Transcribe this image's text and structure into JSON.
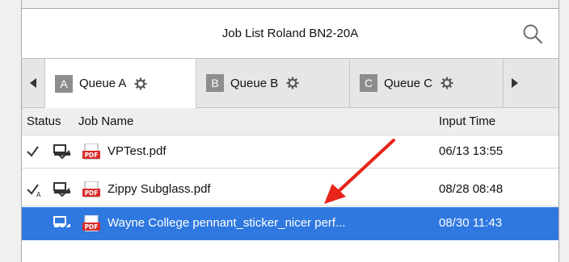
{
  "header": {
    "title": "Job List Roland BN2-20A"
  },
  "tabs": [
    {
      "letter": "A",
      "label": "Queue A",
      "active": true
    },
    {
      "letter": "B",
      "label": "Queue B",
      "active": false
    },
    {
      "letter": "C",
      "label": "Queue C",
      "active": false
    }
  ],
  "columns": {
    "status": "Status",
    "name": "Job Name",
    "time": "Input Time"
  },
  "jobs": [
    {
      "status_icons": [
        "check-icon",
        "printer-icon"
      ],
      "name": "VPTest.pdf",
      "time": "06/13 13:55",
      "selected": false
    },
    {
      "status_icons": [
        "check-a-icon",
        "printer-icon"
      ],
      "name": "Zippy Subglass.pdf",
      "time": "08/28 08:48",
      "selected": false
    },
    {
      "status_icons": [
        "printer-icon"
      ],
      "name": "Wayne College pennant_sticker_nicer perf...",
      "time": "08/30 11:43",
      "selected": true
    }
  ],
  "colors": {
    "selection": "#2f78e0",
    "annotation_arrow": "#e8241a",
    "pdf_red": "#d92b2b"
  }
}
